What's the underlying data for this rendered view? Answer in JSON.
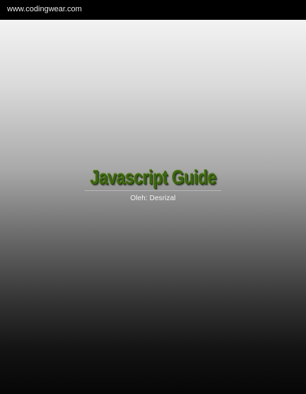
{
  "header": {
    "site_url": "www.codingwear.com"
  },
  "cover": {
    "title": "Javascript Guide",
    "author_line": "Oleh: Desrizal"
  }
}
